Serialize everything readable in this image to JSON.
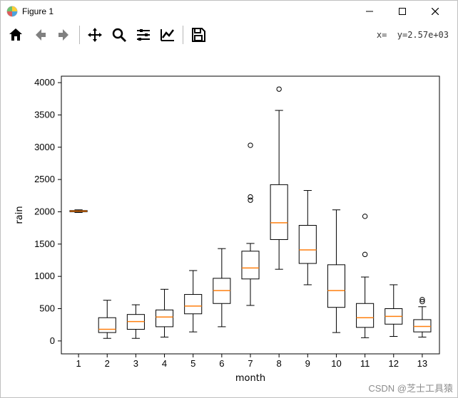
{
  "window": {
    "title": "Figure 1"
  },
  "toolbar": {
    "coord_readout": "x=  y=2.57e+03"
  },
  "watermark": "CSDN @芝士工具猿",
  "chart_data": {
    "type": "box",
    "xlabel": "month",
    "ylabel": "rain",
    "xlim": [
      0.4,
      13.6
    ],
    "ylim": [
      -200,
      4100
    ],
    "yticks": [
      0,
      500,
      1000,
      1500,
      2000,
      2500,
      3000,
      3500,
      4000
    ],
    "categories": [
      "1",
      "2",
      "3",
      "4",
      "5",
      "6",
      "7",
      "8",
      "9",
      "10",
      "11",
      "12",
      "13"
    ],
    "box_color": "#000000",
    "median_color": "#ff7f0e",
    "series": [
      {
        "x": 1,
        "whisker_low": 1990,
        "q1": 2000,
        "median": 2010,
        "q3": 2020,
        "whisker_high": 2030,
        "outliers": []
      },
      {
        "x": 2,
        "whisker_low": 40,
        "q1": 130,
        "median": 180,
        "q3": 360,
        "whisker_high": 630,
        "outliers": []
      },
      {
        "x": 3,
        "whisker_low": 40,
        "q1": 180,
        "median": 300,
        "q3": 410,
        "whisker_high": 560,
        "outliers": []
      },
      {
        "x": 4,
        "whisker_low": 60,
        "q1": 220,
        "median": 370,
        "q3": 480,
        "whisker_high": 800,
        "outliers": []
      },
      {
        "x": 5,
        "whisker_low": 140,
        "q1": 420,
        "median": 540,
        "q3": 720,
        "whisker_high": 1090,
        "outliers": []
      },
      {
        "x": 6,
        "whisker_low": 220,
        "q1": 580,
        "median": 780,
        "q3": 970,
        "whisker_high": 1430,
        "outliers": []
      },
      {
        "x": 7,
        "whisker_low": 550,
        "q1": 960,
        "median": 1130,
        "q3": 1390,
        "whisker_high": 1510,
        "outliers": [
          2180,
          2230,
          3030
        ]
      },
      {
        "x": 8,
        "whisker_low": 1110,
        "q1": 1570,
        "median": 1830,
        "q3": 2420,
        "whisker_high": 3570,
        "outliers": [
          3900
        ]
      },
      {
        "x": 9,
        "whisker_low": 870,
        "q1": 1200,
        "median": 1410,
        "q3": 1790,
        "whisker_high": 2330,
        "outliers": []
      },
      {
        "x": 10,
        "whisker_low": 130,
        "q1": 520,
        "median": 780,
        "q3": 1180,
        "whisker_high": 2030,
        "outliers": []
      },
      {
        "x": 11,
        "whisker_low": 50,
        "q1": 210,
        "median": 360,
        "q3": 580,
        "whisker_high": 990,
        "outliers": [
          1340,
          1930
        ]
      },
      {
        "x": 12,
        "whisker_low": 70,
        "q1": 260,
        "median": 380,
        "q3": 500,
        "whisker_high": 870,
        "outliers": []
      },
      {
        "x": 13,
        "whisker_low": 60,
        "q1": 140,
        "median": 225,
        "q3": 330,
        "whisker_high": 530,
        "outliers": [
          610,
          640
        ]
      }
    ]
  }
}
